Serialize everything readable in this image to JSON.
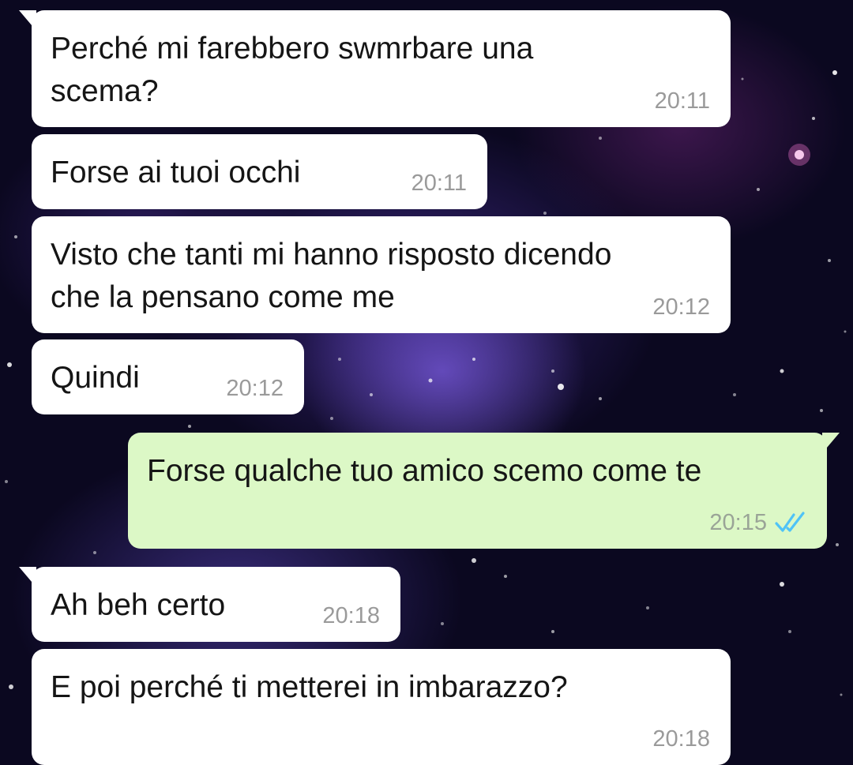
{
  "messages": [
    {
      "direction": "incoming",
      "text": "Perché mi farebbero swmrbare una\nscema?",
      "time": "20:11"
    },
    {
      "direction": "incoming",
      "text": "Forse ai tuoi occhi",
      "time": "20:11"
    },
    {
      "direction": "incoming",
      "text": "Visto che tanti mi hanno risposto dicendo\nche la pensano come me",
      "time": "20:12"
    },
    {
      "direction": "incoming",
      "text": "Quindi",
      "time": "20:12"
    },
    {
      "direction": "outgoing",
      "text": "Forse qualche tuo amico scemo come te",
      "time": "20:15",
      "status": "read"
    },
    {
      "direction": "incoming",
      "text": "Ah beh certo",
      "time": "20:18"
    },
    {
      "direction": "incoming",
      "text": "E poi perché ti metterei in imbarazzo?",
      "time": "20:18"
    }
  ],
  "colors": {
    "incoming_bubble": "#ffffff",
    "outgoing_bubble": "#dcf8c6",
    "read_ticks": "#4fc3f7",
    "timestamp": "#9a9a9a"
  },
  "icons": {
    "read_receipt": "double-check-icon"
  }
}
